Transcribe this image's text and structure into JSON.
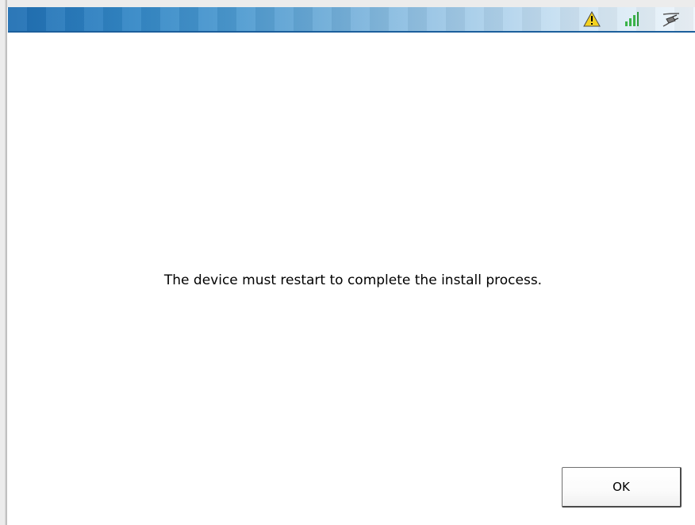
{
  "status_bar": {
    "icons": [
      "warning-icon",
      "signal-strength-icon",
      "power-plug-icon"
    ],
    "colors": {
      "gradient_start": "#1f6fb3",
      "gradient_end": "#eef5fb",
      "signal": "#3bb34a",
      "warning": "#f4d21f"
    }
  },
  "dialog": {
    "message": "The device must restart to complete the install process.",
    "ok_label": "OK"
  }
}
